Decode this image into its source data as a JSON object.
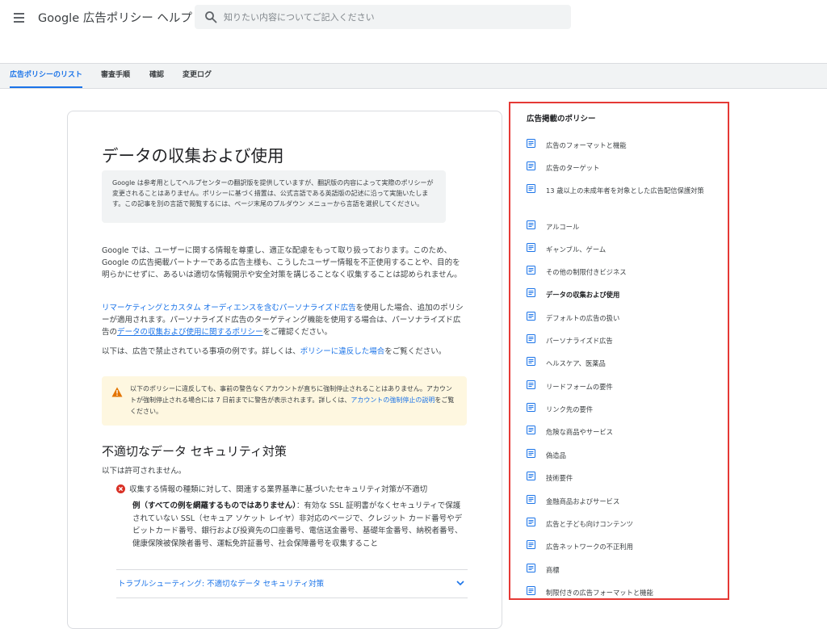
{
  "header": {
    "app_title": "Google 広告ポリシー ヘルプ",
    "search_placeholder": "知りたい内容についてご記入ください"
  },
  "tabs": [
    {
      "label": "広告ポリシーのリスト",
      "active": true
    },
    {
      "label": "審査手順",
      "active": false
    },
    {
      "label": "確認",
      "active": false
    },
    {
      "label": "変更ログ",
      "active": false
    }
  ],
  "article": {
    "title": "データの収集および使用",
    "translation_notice": "Google は参考用としてヘルプセンターの翻訳版を提供していますが、翻訳版の内容によって実際のポリシーが変更されることはありません。ポリシーに基づく措置は、公式言語である英語版の記述に沿って実施いたします。この記事を別の言語で閲覧するには、ページ末尾のプルダウン メニューから言語を選択してください。",
    "intro": "Google では、ユーザーに関する情報を尊重し、適正な配慮をもって取り扱っております。このため、Google の広告掲載パートナーである広告主様も、こうしたユーザー情報を不正使用することや、目的を明らかにせずに、あるいは適切な情報開示や安全対策を講じることなく収集することは認められません。",
    "p2_link1": "リマーケティングとカスタム オーディエンスを含むパーソナライズド広告",
    "p2_text1": "を使用した場合、追加のポリシーが適用されます。パーソナライズド広告のターゲティング機能を使用する場合は、パーソナライズド広告の",
    "p2_link2": "データの収集および使用に関するポリシー",
    "p2_text2": "をご確認ください。",
    "p3_text1": "以下は、広告で禁止されている事項の例です。詳しくは、",
    "p3_link": "ポリシーに違反した場合",
    "p3_text2": "をご覧ください。",
    "warning_text": "以下のポリシーに違反しても、事前の警告なくアカウントが直ちに強制停止されることはありません。アカウントが強制停止される場合には 7 日前までに警告が表示されます。詳しくは、",
    "warning_link": "アカウントの強制停止の説明",
    "warning_text2": "をご覧ください。",
    "section_title": "不適切なデータ セキュリティ対策",
    "not_allowed": "以下は許可されません。",
    "bullet": "収集する情報の種類に対して、関連する業界基準に基づいたセキュリティ対策が不適切",
    "example_label": "例（すべての例を網羅するものではありません）",
    "example_text": "：有効な SSL 証明書がなくセキュリティで保護されていない SSL（セキュア ソケット レイヤ）非対応のページで、クレジット カード番号やデビットカード番号、銀行および投資先の口座番号、電信送金番号、基礎年金番号、納税者番号、健康保険被保険者番号、運転免許証番号、社会保障番号を収集すること",
    "troubleshoot": "トラブルシューティング: 不適切なデータ セキュリティ対策"
  },
  "sidebar": {
    "heading": "広告掲載のポリシー",
    "items": [
      {
        "label": "広告のフォーマットと機能",
        "current": false
      },
      {
        "label": "広告のターゲット",
        "current": false
      },
      {
        "label": "13 歳以上の未成年者を対象とした広告配信保護対策",
        "current": false
      },
      {
        "label": "アルコール",
        "current": false
      },
      {
        "label": "ギャンブル、ゲーム",
        "current": false
      },
      {
        "label": "その他の制限付きビジネス",
        "current": false
      },
      {
        "label": "データの収集および使用",
        "current": true
      },
      {
        "label": "デフォルトの広告の扱い",
        "current": false
      },
      {
        "label": "パーソナライズド広告",
        "current": false
      },
      {
        "label": "ヘルスケア、医薬品",
        "current": false
      },
      {
        "label": "リードフォームの要件",
        "current": false
      },
      {
        "label": "リンク先の要件",
        "current": false
      },
      {
        "label": "危険な商品やサービス",
        "current": false
      },
      {
        "label": "偽造品",
        "current": false
      },
      {
        "label": "技術要件",
        "current": false
      },
      {
        "label": "金融商品およびサービス",
        "current": false
      },
      {
        "label": "広告と子ども向けコンテンツ",
        "current": false
      },
      {
        "label": "広告ネットワークの不正利用",
        "current": false
      },
      {
        "label": "商標",
        "current": false
      },
      {
        "label": "制限付きの広告フォーマットと機能",
        "current": false
      }
    ]
  },
  "colors": {
    "accent": "#1a73e8",
    "highlight_border": "#e53935",
    "warning_bg": "#fef7e0",
    "warning_icon": "#e37400",
    "error_icon": "#d93025"
  },
  "icons": {
    "menu": "hamburger-menu-icon",
    "search": "search-icon",
    "warning": "warning-icon",
    "error": "error-icon",
    "doc": "document-icon",
    "chevron": "chevron-down-icon"
  }
}
